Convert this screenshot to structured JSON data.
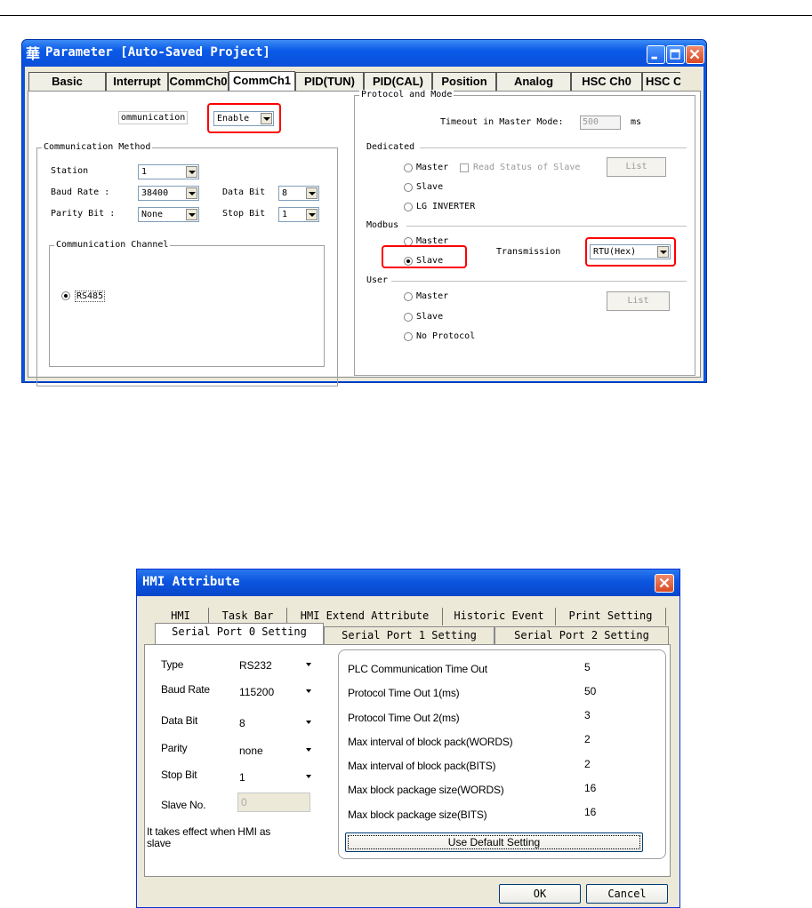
{
  "parameter_window": {
    "title": "Parameter [Auto-Saved Project]",
    "app_icon": "華",
    "tabs": [
      "Basic",
      "Interrupt",
      "CommCh0",
      "CommCh1",
      "PID(TUN)",
      "PID(CAL)",
      "Position",
      "Analog",
      "HSC Ch0",
      "HSC C"
    ],
    "active_tab": "CommCh1",
    "communication_label": "ommunication",
    "communication_value": "Enable",
    "comm_method": {
      "title": "Communication Method",
      "station_label": "Station",
      "station_value": "1",
      "baud_label": "Baud Rate :",
      "baud_value": "38400",
      "databit_label": "Data Bit",
      "databit_value": "8",
      "parity_label": "Parity Bit :",
      "parity_value": "None",
      "stopbit_label": "Stop Bit",
      "stopbit_value": "1"
    },
    "comm_channel": {
      "title": "Communication Channel",
      "rs485_label": "RS485"
    },
    "protocol": {
      "title": "Protocol and Mode",
      "timeout_label": "Timeout in Master Mode:",
      "timeout_value": "500",
      "timeout_unit": "ms",
      "dedicated_label": "Dedicated",
      "ded_master": "Master",
      "ded_read_status": "Read Status of Slave",
      "ded_list": "List",
      "ded_slave": "Slave",
      "ded_lg": "LG INVERTER",
      "modbus_label": "Modbus",
      "mod_master": "Master",
      "mod_slave": "Slave",
      "transmission_label": "Transmission",
      "transmission_value": "RTU(Hex)",
      "user_label": "User",
      "user_master": "Master",
      "user_slave": "Slave",
      "user_noprotocol": "No Protocol",
      "user_list": "List"
    }
  },
  "hmi_window": {
    "title": "HMI Attribute",
    "tabs_row1": [
      "HMI",
      "Task Bar",
      "HMI Extend Attribute",
      "Historic Event",
      "Print Setting"
    ],
    "tabs_row2": [
      "Serial Port 0 Setting",
      "Serial Port 1 Setting",
      "Serial Port 2 Setting"
    ],
    "active_tab": "Serial Port 0 Setting",
    "fields": {
      "type_label": "Type",
      "type_value": "RS232",
      "baud_label": "Baud Rate",
      "baud_value": "115200",
      "databit_label": "Data Bit",
      "databit_value": "8",
      "parity_label": "Parity",
      "parity_value": "none",
      "stopbit_label": "Stop Bit",
      "stopbit_value": "1",
      "slave_label": "Slave No.",
      "slave_value": "0"
    },
    "note": [
      "It takes effect when HMI as",
      "slave"
    ],
    "settings": [
      {
        "label": "PLC Communication Time Out",
        "value": "5"
      },
      {
        "label": "Protocol Time Out 1(ms)",
        "value": "50"
      },
      {
        "label": "Protocol Time Out 2(ms)",
        "value": "3"
      },
      {
        "label": "Max interval of block pack(WORDS)",
        "value": "2"
      },
      {
        "label": "Max interval of block pack(BITS)",
        "value": "2"
      },
      {
        "label": "Max block package size(WORDS)",
        "value": "16"
      },
      {
        "label": "Max block package size(BITS)",
        "value": "16"
      }
    ],
    "default_button": "Use Default Setting",
    "ok_button": "OK",
    "cancel_button": "Cancel"
  }
}
